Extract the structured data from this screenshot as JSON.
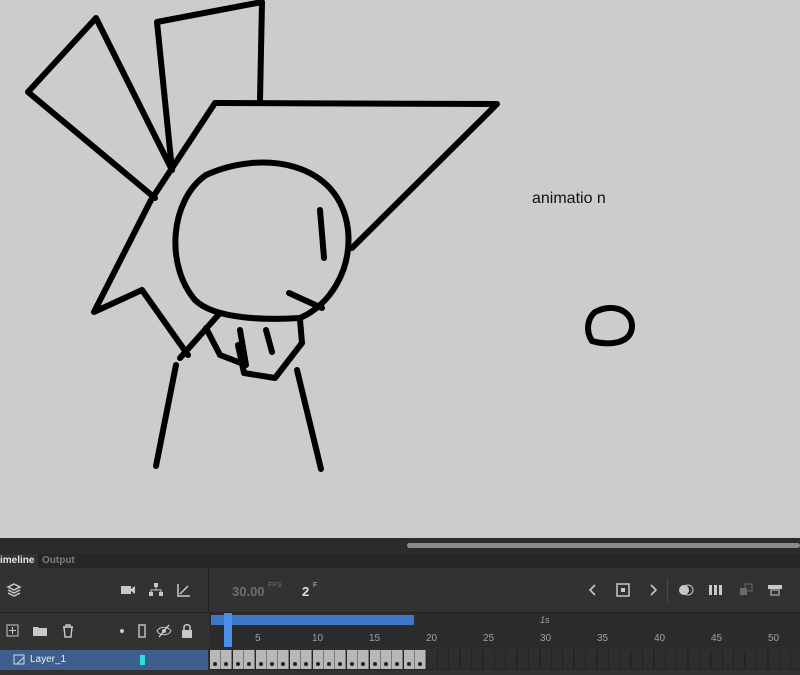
{
  "stage": {
    "text": "animatio n"
  },
  "timeline": {
    "tabs": [
      "imeline",
      "Output"
    ],
    "fps_value": "30.00",
    "fps_unit": "FPS",
    "current_frame": "2",
    "frame_unit": "F",
    "ruler_ticks": [
      "5",
      "10",
      "15",
      "20",
      "25",
      "30",
      "35",
      "40",
      "45",
      "50"
    ],
    "second_label": "1s",
    "layer": {
      "name": "Layer_1",
      "color": "#28e0e0"
    },
    "filled_frames": 19,
    "total_visible_frames": 55
  },
  "icons": {
    "layers": "layers-icon",
    "camera": "camera-icon",
    "hierarchy": "layer-parenting-icon",
    "graph": "graph-icon",
    "new_layer": "add-layer-icon",
    "new_folder": "folder-icon",
    "delete": "trash-icon",
    "show_all": "dot-icon",
    "outline": "outline-icon",
    "visibility": "eye-slash-icon",
    "lock": "lock-icon",
    "prev": "chevron-left-icon",
    "stop": "stop-icon",
    "next": "chevron-right-icon",
    "onion": "onion-skin-icon",
    "edit_multiple": "edit-multiple-frames-icon",
    "sync": "sync-icon",
    "frames": "frame-view-icon"
  }
}
